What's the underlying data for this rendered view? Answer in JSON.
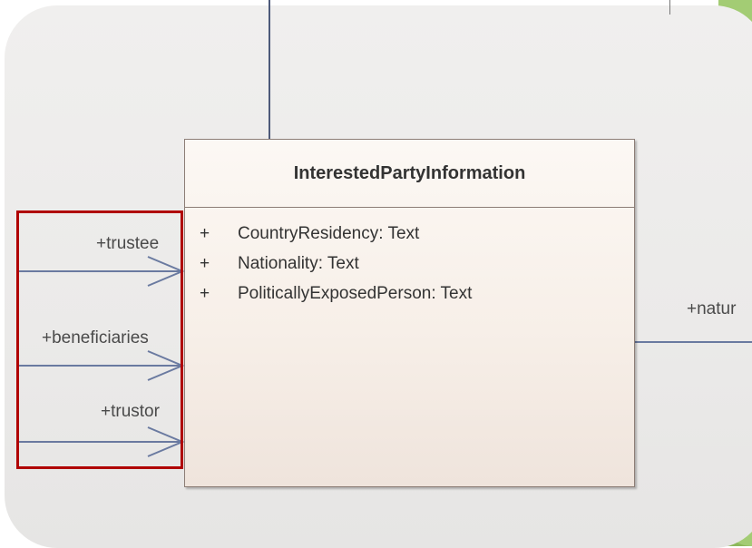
{
  "class": {
    "name": "InterestedPartyInformation",
    "attributes": [
      {
        "visibility": "+",
        "text": "CountryResidency: Text"
      },
      {
        "visibility": "+",
        "text": "Nationality: Text"
      },
      {
        "visibility": "+",
        "text": "PoliticallyExposedPerson: Text"
      }
    ]
  },
  "associations": {
    "left": [
      "+trustee",
      "+beneficiaries",
      "+trustor"
    ],
    "right": "+natur"
  },
  "colors": {
    "connector": "#6a7aa0",
    "highlight": "#b00000",
    "class_fill": "#f7efe8"
  }
}
